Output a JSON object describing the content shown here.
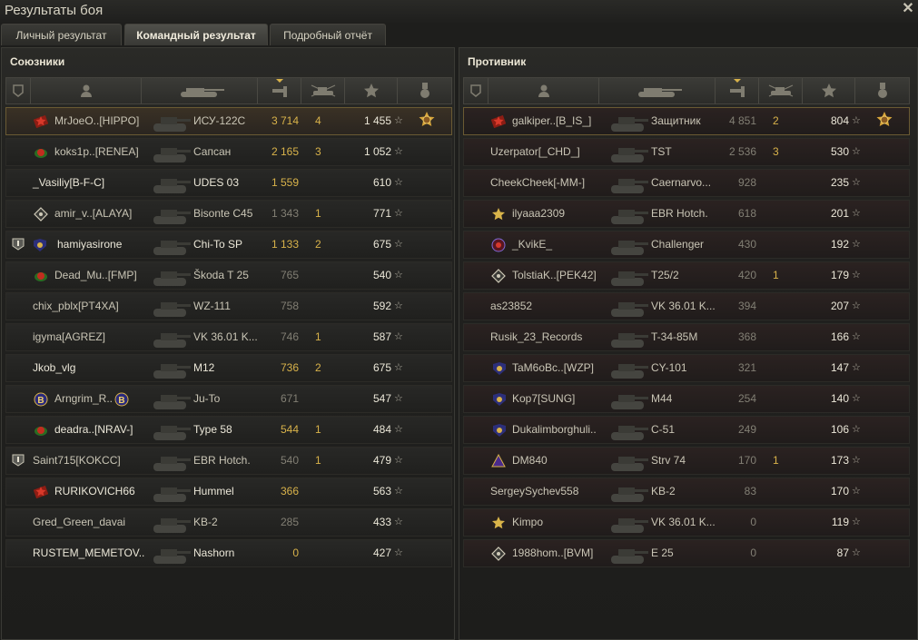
{
  "window": {
    "title": "Результаты боя"
  },
  "tabs": [
    {
      "label": "Личный результат",
      "active": false
    },
    {
      "label": "Командный результат",
      "active": true
    },
    {
      "label": "Подробный отчёт",
      "active": false
    }
  ],
  "icons": {
    "platoon": "platoon-icon",
    "player": "player-icon",
    "tank": "tank-icon",
    "damage": "damage-icon",
    "kills": "kills-icon",
    "xp": "star-icon",
    "medal": "medal-icon",
    "close": "close-icon"
  },
  "colors": {
    "gold": "#d8b24a",
    "accent": "#d8b24a",
    "text": "#c9c5b5",
    "dim": "#827f74"
  },
  "allies": {
    "title": "Союзники",
    "rows": [
      {
        "name": "MrJoeO..[HIPPO]",
        "tank": "ИСУ-122С",
        "damage": "3 714",
        "kills": "4",
        "xp": "1 455",
        "badge": "red-star",
        "medal": true,
        "hl": true,
        "dmgStyle": "gold"
      },
      {
        "name": "koks1p..[RENEA]",
        "tank": "Сапсан",
        "damage": "2 165",
        "kills": "3",
        "xp": "1 052",
        "badge": "red-green",
        "dmgStyle": "gold"
      },
      {
        "name": "_Vasiliy[B-F-C]",
        "tank": "UDES 03",
        "damage": "1 559",
        "kills": "",
        "xp": "610",
        "dmgStyle": "gold",
        "bright": true
      },
      {
        "name": "amir_v..[ALAYA]",
        "tank": "Bisonte C45",
        "damage": "1 343",
        "kills": "1",
        "xp": "771",
        "badge": "diamond",
        "dmgStyle": "dim"
      },
      {
        "name": "hamiyasirone",
        "tank": "Chi-To SP",
        "damage": "1 133",
        "kills": "2",
        "xp": "675",
        "badge": "emblem",
        "platoon": true,
        "dmgStyle": "gold",
        "bright": true
      },
      {
        "name": "Dead_Mu..[FMP]",
        "tank": "Škoda T 25",
        "damage": "765",
        "kills": "",
        "xp": "540",
        "badge": "red-green",
        "dmgStyle": "dim"
      },
      {
        "name": "chix_pblx[PT4XA]",
        "tank": "WZ-111",
        "damage": "758",
        "kills": "",
        "xp": "592",
        "dmgStyle": "dim"
      },
      {
        "name": "igyma[AGREZ]",
        "tank": "VK 36.01 K...",
        "damage": "746",
        "kills": "1",
        "xp": "587",
        "dmgStyle": "dim"
      },
      {
        "name": "Jkob_vlg",
        "tank": "M12",
        "damage": "736",
        "kills": "2",
        "xp": "675",
        "dmgStyle": "gold",
        "bright": true
      },
      {
        "name": "Arngrim_R..",
        "tank": "Ju-To",
        "damage": "671",
        "kills": "",
        "xp": "547",
        "badge": "b-blue",
        "badge2": true,
        "dmgStyle": "dim"
      },
      {
        "name": "deadra..[NRAV-]",
        "tank": "Type 58",
        "damage": "544",
        "kills": "1",
        "xp": "484",
        "badge": "red-green",
        "dmgStyle": "gold",
        "bright": true
      },
      {
        "name": "Saint715[KOKCC]",
        "tank": "EBR Hotch.",
        "damage": "540",
        "kills": "1",
        "xp": "479",
        "platoon": true,
        "dmgStyle": "dim"
      },
      {
        "name": "RURIKOVICH66",
        "tank": "Hummel",
        "damage": "366",
        "kills": "",
        "xp": "563",
        "badge": "red-star",
        "dmgStyle": "gold",
        "bright": true
      },
      {
        "name": "Gred_Green_davai",
        "tank": "KB-2",
        "damage": "285",
        "kills": "",
        "xp": "433",
        "dmgStyle": "dim"
      },
      {
        "name": "RUSTEM_MEMETOV..",
        "tank": "Nashorn",
        "damage": "0",
        "kills": "",
        "xp": "427",
        "dmgStyle": "gold",
        "bright": true
      }
    ]
  },
  "enemies": {
    "title": "Противник",
    "rows": [
      {
        "name": "galkiper..[B_IS_]",
        "tank": "Защитник",
        "damage": "4 851",
        "kills": "2",
        "xp": "804",
        "badge": "red-star",
        "medal": true,
        "hl": true,
        "dmgStyle": "dim"
      },
      {
        "name": "Uzerpator[_CHD_]",
        "tank": "TST",
        "damage": "2 536",
        "kills": "3",
        "xp": "530",
        "dmgStyle": "dim"
      },
      {
        "name": "CheekCheek[-MM-]",
        "tank": "Caernarvo...",
        "damage": "928",
        "kills": "",
        "xp": "235",
        "dmgStyle": "dim"
      },
      {
        "name": "ilyaaa2309",
        "tank": "EBR Hotch.",
        "damage": "618",
        "kills": "",
        "xp": "201",
        "badge": "gold-star",
        "dmgStyle": "dim"
      },
      {
        "name": "_KvikE_",
        "tank": "Challenger",
        "damage": "430",
        "kills": "",
        "xp": "192",
        "badge": "target",
        "dmgStyle": "dim"
      },
      {
        "name": "TolstiaK..[PEK42]",
        "tank": "T25/2",
        "damage": "420",
        "kills": "1",
        "xp": "179",
        "badge": "diamond",
        "dmgStyle": "dim"
      },
      {
        "name": "as23852",
        "tank": "VK 36.01 K...",
        "damage": "394",
        "kills": "",
        "xp": "207",
        "dmgStyle": "dim"
      },
      {
        "name": "Rusik_23_Records",
        "tank": "T-34-85M",
        "damage": "368",
        "kills": "",
        "xp": "166",
        "dmgStyle": "dim"
      },
      {
        "name": "TaM6oBc..[WZP]",
        "tank": "CY-101",
        "damage": "321",
        "kills": "",
        "xp": "147",
        "badge": "emblem",
        "dmgStyle": "dim"
      },
      {
        "name": "Kop7[SUNG]",
        "tank": "M44",
        "damage": "254",
        "kills": "",
        "xp": "140",
        "badge": "emblem",
        "dmgStyle": "dim"
      },
      {
        "name": "Dukalimborghuli..",
        "tank": "C-51",
        "damage": "249",
        "kills": "",
        "xp": "106",
        "badge": "emblem",
        "dmgStyle": "dim"
      },
      {
        "name": "DM840",
        "tank": "Strv 74",
        "damage": "170",
        "kills": "1",
        "xp": "173",
        "badge": "triangle",
        "dmgStyle": "dim"
      },
      {
        "name": "SergeySychev558",
        "tank": "KB-2",
        "damage": "83",
        "kills": "",
        "xp": "170",
        "dmgStyle": "dim"
      },
      {
        "name": "Kimpo",
        "tank": "VK 36.01 K...",
        "damage": "0",
        "kills": "",
        "xp": "119",
        "badge": "gold-star",
        "dmgStyle": "dim"
      },
      {
        "name": "1988hom..[BVM]",
        "tank": "E 25",
        "damage": "0",
        "kills": "",
        "xp": "87",
        "badge": "diamond",
        "dmgStyle": "dim"
      }
    ]
  }
}
